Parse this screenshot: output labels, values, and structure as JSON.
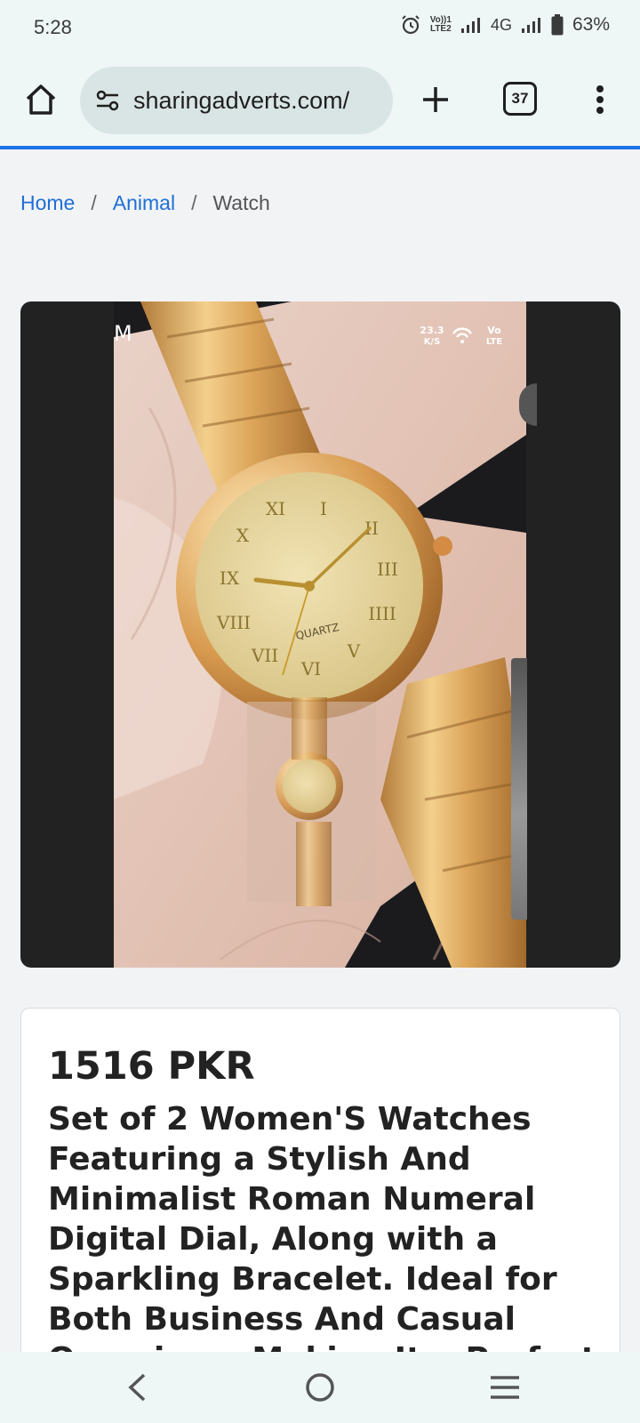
{
  "status_bar": {
    "time": "5:28",
    "net_top": "Vo))1",
    "net_bottom": "LTE2",
    "network_type": "4G",
    "battery": "63%"
  },
  "browser": {
    "url": "sharingadverts.com/",
    "tab_count": "37"
  },
  "breadcrumb": {
    "items": [
      {
        "label": "Home"
      },
      {
        "label": "Animal"
      },
      {
        "label": "Watch"
      }
    ],
    "separator": "/"
  },
  "product_image": {
    "overlay_speed_value": "23.3",
    "overlay_speed_unit": "K/S",
    "overlay_vo": "Vo",
    "overlay_lte": "LTE",
    "dial_text": "QUARTZ"
  },
  "product": {
    "price": "1516 PKR",
    "title": "Set of 2 Women'S Watches Featuring a Stylish And Minimalist Roman Numeral Digital Dial, Along with a Sparkling Bracelet. Ideal for Both Business And Casual Occasions, Making It a Perfect"
  },
  "colors": {
    "accent": "#1a73e8",
    "link": "#1f6fd6",
    "gold": "#d9a85a"
  }
}
